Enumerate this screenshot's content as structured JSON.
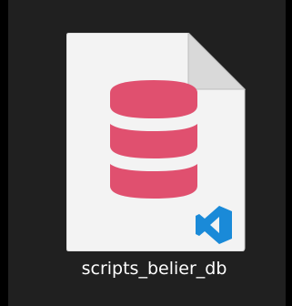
{
  "file": {
    "name": "scripts_belier_db",
    "icon": "sql-file-icon",
    "badge_icon": "vscode-icon",
    "glyph_icon": "database-icon"
  },
  "colors": {
    "background": "#000000",
    "tile": "#202020",
    "page": "#f3f3f3",
    "page_fold": "#d6d6d6",
    "database": "#e0506f",
    "vscode": "#1a8ad8",
    "label_text": "#ffffff"
  }
}
